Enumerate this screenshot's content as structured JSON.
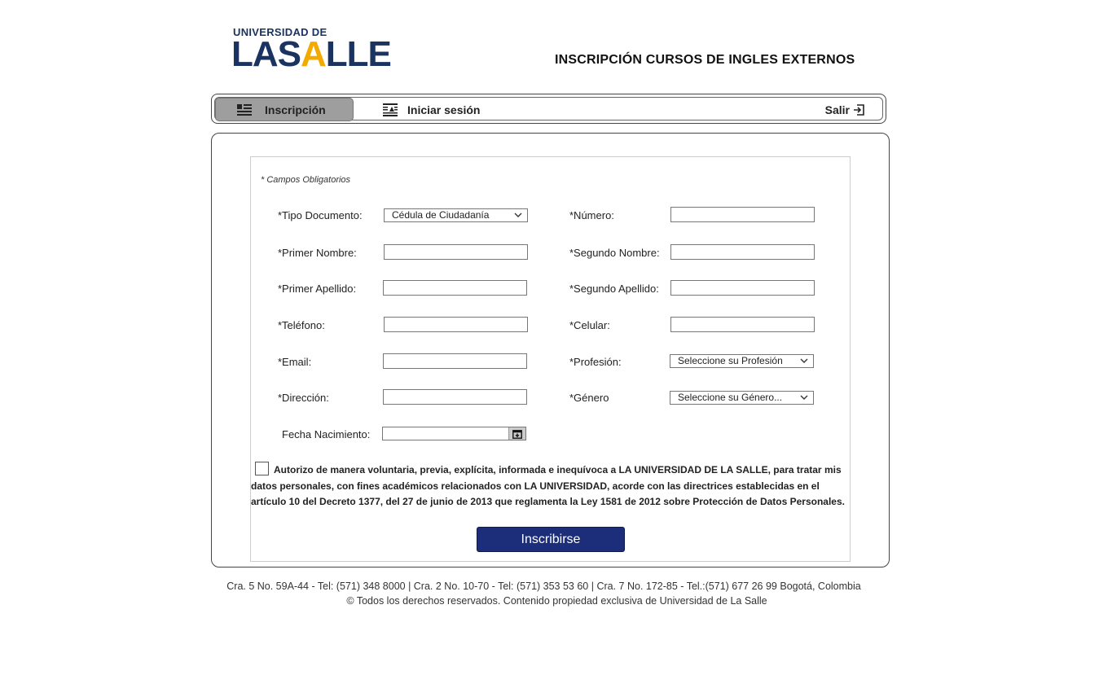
{
  "header": {
    "logo_top": "UNIVERSIDAD DE",
    "logo_main_part1": "LAS",
    "logo_main_accent": "A",
    "logo_main_part2": "LLE",
    "title": "INSCRIPCIÓN CURSOS DE INGLES EXTERNOS"
  },
  "nav": {
    "items": [
      {
        "label": "Inscripción",
        "icon": "list-icon",
        "active": true
      },
      {
        "label": "Iniciar sesión",
        "icon": "login-form-icon",
        "active": false
      }
    ],
    "logout_label": "Salir",
    "logout_icon": "exit-icon"
  },
  "form": {
    "required_note": "* Campos Obligatorios",
    "fields": {
      "tipo_documento": {
        "label": "*Tipo Documento:",
        "value": "Cédula de Ciudadanía"
      },
      "numero": {
        "label": "*Número:",
        "value": ""
      },
      "primer_nombre": {
        "label": "*Primer Nombre:",
        "value": ""
      },
      "segundo_nombre": {
        "label": "*Segundo Nombre:",
        "value": ""
      },
      "primer_apellido": {
        "label": "*Primer Apellido:",
        "value": ""
      },
      "segundo_apellido": {
        "label": "*Segundo Apellido:",
        "value": ""
      },
      "telefono": {
        "label": "*Teléfono:",
        "value": ""
      },
      "celular": {
        "label": "*Celular:",
        "value": ""
      },
      "email": {
        "label": "*Email:",
        "value": ""
      },
      "profesion": {
        "label": "*Profesión:",
        "value": "Seleccione su Profesión"
      },
      "direccion": {
        "label": "*Dirección:",
        "value": ""
      },
      "genero": {
        "label": "*Género",
        "value": "Seleccione su Género..."
      },
      "fecha_nacimiento": {
        "label": "Fecha Nacimiento:",
        "value": ""
      }
    },
    "consent_checked": false,
    "consent_text": "Autorizo de manera voluntaria, previa, explícita, informada e inequívoca a LA UNIVERSIDAD DE LA SALLE, para tratar mis datos personales, con fines académicos relacionados con LA UNIVERSIDAD, acorde con las directrices establecidas en el artículo 10 del Decreto 1377, del 27 de junio de 2013 que reglamenta la Ley 1581 de 2012 sobre Protección de Datos Personales.",
    "submit_label": "Inscribirse"
  },
  "footer": {
    "line1": "Cra. 5 No. 59A-44 - Tel: (571) 348 8000 | Cra. 2 No. 10-70 - Tel: (571) 353 53 60 | Cra. 7 No. 172-85 - Tel.:(571) 677 26 99 Bogotá, Colombia",
    "line2": "© Todos los derechos reservados. Contenido propiedad exclusiva de Universidad de La Salle"
  },
  "colors": {
    "brand_navy": "#1a3360",
    "brand_gold": "#f2a900",
    "button_bg": "#1c2e7a",
    "nav_active_bg": "#9e9e9e"
  }
}
